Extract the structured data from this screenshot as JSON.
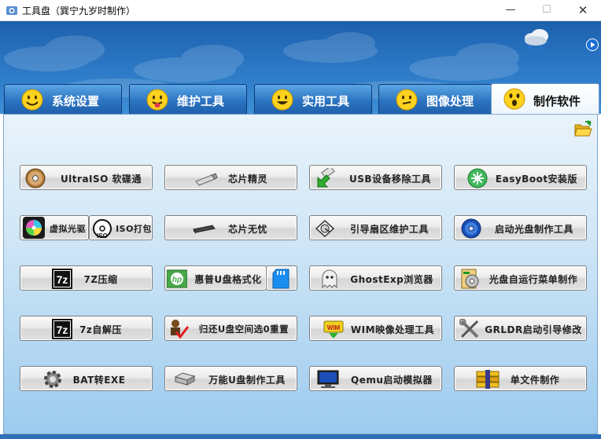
{
  "window": {
    "title": "工具盘（巽宁九岁时制作）",
    "minimize_label": "—",
    "maximize_label": "☐",
    "close_label": "✕"
  },
  "tabs": [
    {
      "label": "系统设置",
      "active": false,
      "icon": "smile-face-icon"
    },
    {
      "label": "维护工具",
      "active": false,
      "icon": "tongue-face-icon"
    },
    {
      "label": "实用工具",
      "active": false,
      "icon": "grin-face-icon"
    },
    {
      "label": "图像处理",
      "active": false,
      "icon": "confused-face-icon"
    },
    {
      "label": "制作软件",
      "active": true,
      "icon": "surprised-face-icon"
    }
  ],
  "buttons": {
    "ultraiso": "UltraISO 软碟通",
    "chip_wizard": "芯片精灵",
    "usb_remove": "USB设备移除工具",
    "easyboot": "EasyBoot安装版",
    "virtual_cd": "虚拟光驱",
    "iso_pack": "ISO打包",
    "chip_worry": "芯片无忧",
    "boot_sector": "引导扇区维护工具",
    "boot_cd": "启动光盘制作工具",
    "zip7": "7Z压缩",
    "hp_format": "惠普U盘格式化",
    "ghostexp": "GhostExp浏览器",
    "autorun": "光盘自运行菜单制作",
    "zip7_sfx": "7z自解压",
    "restore_udisk": "归还U盘空间选0重置",
    "wim": "WIM映像处理工具",
    "grldr": "GRLDR启动引导修改",
    "bat_exe": "BAT转EXE",
    "udisk_maker": "万能U盘制作工具",
    "qemu": "Qemu启动模拟器",
    "single_file": "单文件制作"
  },
  "colors": {
    "header_blue": "#2a76c3",
    "tab_blue": "#2c74c2",
    "content_light": "#e9f3fb",
    "content_dark": "#9ccbee"
  }
}
